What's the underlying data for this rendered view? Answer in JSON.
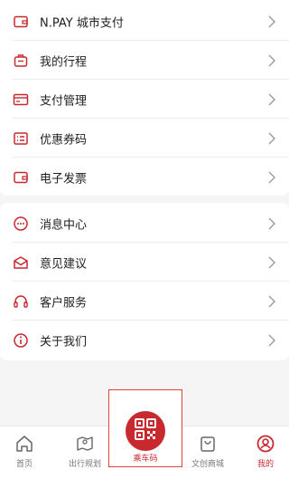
{
  "menu_group_1": [
    {
      "label": "N.PAY 城市支付",
      "icon": "wallet-icon"
    },
    {
      "label": "我的行程",
      "icon": "luggage-icon"
    },
    {
      "label": "支付管理",
      "icon": "card-icon"
    },
    {
      "label": "优惠券码",
      "icon": "coupon-icon"
    },
    {
      "label": "电子发票",
      "icon": "invoice-icon"
    }
  ],
  "menu_group_2": [
    {
      "label": "消息中心",
      "icon": "message-icon"
    },
    {
      "label": "意见建议",
      "icon": "feedback-icon"
    },
    {
      "label": "客户服务",
      "icon": "headset-icon"
    },
    {
      "label": "关于我们",
      "icon": "info-icon"
    }
  ],
  "tabbar": {
    "home": "首页",
    "trip": "出行规划",
    "qr": "乘车码",
    "shop": "文创商城",
    "mine": "我的",
    "active": "mine"
  },
  "colors": {
    "accent": "#c8292f",
    "background": "#f5f5f5",
    "highlight_border": "#e0433b"
  }
}
